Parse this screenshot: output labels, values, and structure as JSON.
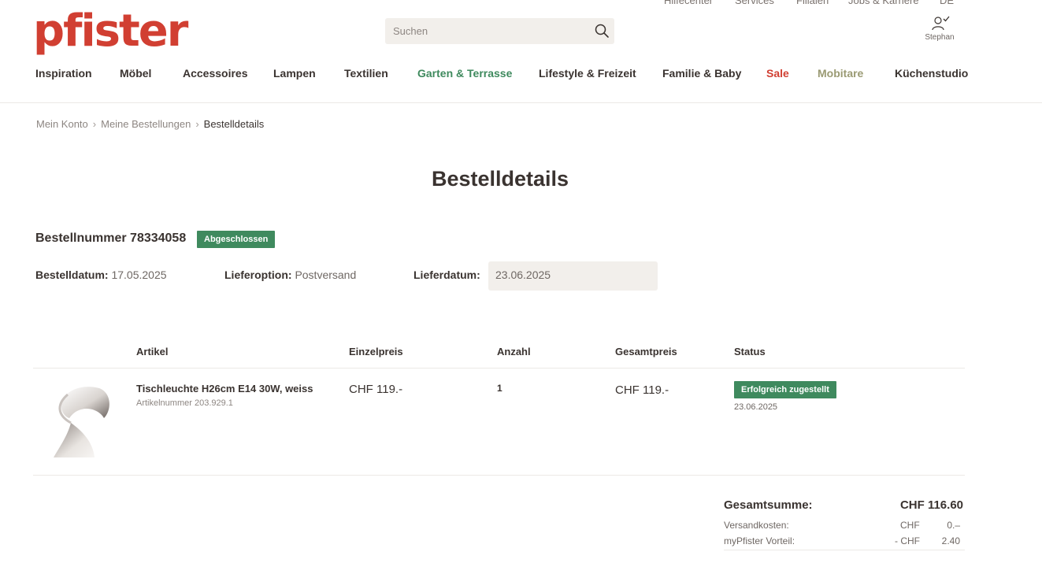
{
  "top_links": [
    "Hilfecenter",
    "Services",
    "Filialen",
    "Jobs & Karriere",
    "DE"
  ],
  "logo": "pfister",
  "search": {
    "placeholder": "Suchen"
  },
  "account": {
    "name": "Stephan"
  },
  "nav": [
    "Inspiration",
    "Möbel",
    "Accessoires",
    "Lampen",
    "Textilien",
    "Garten & Terrasse",
    "Lifestyle & Freizeit",
    "Familie & Baby",
    "Sale",
    "Mobitare",
    "Küchenstudio"
  ],
  "breadcrumb": [
    "Mein Konto",
    "Meine Bestellungen",
    "Bestelldetails"
  ],
  "page_title": "Bestelldetails",
  "order": {
    "number_label": "Bestellnummer 78334058",
    "status": "Abgeschlossen",
    "order_date_label": "Bestelldatum:",
    "order_date": "17.05.2025",
    "delivery_option_label": "Lieferoption:",
    "delivery_option": "Postversand",
    "delivery_date_label": "Lieferdatum:",
    "delivery_date": "23.06.2025"
  },
  "table": {
    "headers": [
      "Artikel",
      "Einzelpreis",
      "Anzahl",
      "Gesamtpreis",
      "Status"
    ],
    "items": [
      {
        "name": "Tischleuchte H26cm E14 30W, weiss",
        "sku": "Artikelnummer 203.929.1",
        "unit_price": "CHF 119.-",
        "quantity": "1",
        "total_price": "CHF 119.-",
        "status": "Erfolgreich zugestellt",
        "status_date": "23.06.2025"
      }
    ]
  },
  "summary": {
    "total_label": "Gesamtsumme:",
    "total_value": "CHF 116.60",
    "shipping_label": "Versandkosten:",
    "shipping_currency": "CHF",
    "shipping_value": "0.–",
    "discount_label": "myPfister Vorteil:",
    "discount_currency": "- CHF",
    "discount_value": "2.40"
  },
  "colors": {
    "brand": "#d13f32",
    "success": "#3f8a5e",
    "garden": "#3f8a5e",
    "mobitare": "#9a9a73"
  }
}
